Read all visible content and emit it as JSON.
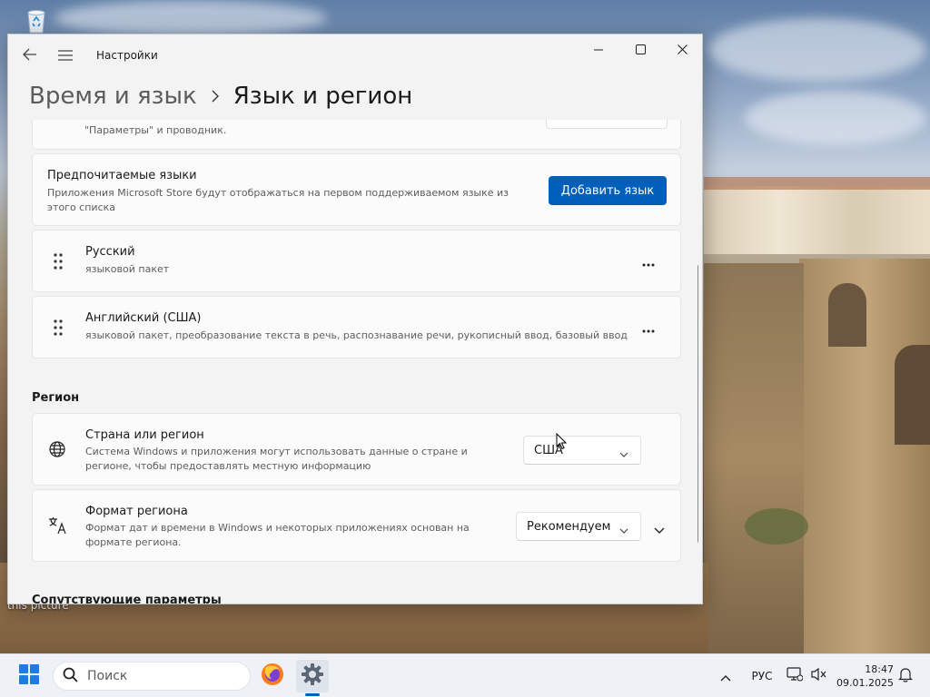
{
  "desktop": {
    "recycle_bin_icon": "recycle-bin-icon",
    "label": "this picture"
  },
  "window": {
    "app_title": "Настройки",
    "back_icon": "back-arrow-icon",
    "menu_icon": "hamburger-menu-icon",
    "controls": [
      "minimize-icon",
      "maximize-icon",
      "close-icon"
    ],
    "breadcrumb": {
      "parent": "Время и язык",
      "separator_icon": "chevron-right-icon",
      "current": "Язык и регион"
    }
  },
  "top_card": {
    "subtitle": "\"Параметры\" и проводник."
  },
  "preferred_languages": {
    "title": "Предпочитаемые языки",
    "subtitle": "Приложения Microsoft Store будут отображаться на первом поддерживаемом языке из этого списка",
    "add_button": "Добавить язык"
  },
  "languages": [
    {
      "name": "Русский",
      "details": "языковой пакет",
      "more_icon": "more-dots-icon",
      "grip_icon": "drag-handle-icon"
    },
    {
      "name": "Английский (США)",
      "details": "языковой пакет, преобразование текста в речь, распознавание речи, рукописный ввод, базовый ввод",
      "more_icon": "more-dots-icon",
      "grip_icon": "drag-handle-icon"
    }
  ],
  "region": {
    "section_title": "Регион",
    "country": {
      "icon": "globe-icon",
      "title": "Страна или регион",
      "subtitle": "Система Windows и приложения могут использовать данные о стране и регионе, чтобы предоставлять местную информацию",
      "value": "США"
    },
    "format": {
      "icon": "language-format-icon",
      "title": "Формат региона",
      "subtitle": "Формат дат и времени в Windows и некоторых приложениях основан на формате региона.",
      "value": "Рекомендуем",
      "expand_icon": "chevron-down-icon"
    }
  },
  "related": {
    "section_title": "Сопутствующие параметры"
  },
  "taskbar": {
    "start_icon": "windows-start-icon",
    "search_placeholder": "Поиск",
    "search_icon": "search-icon",
    "apps": [
      "firefox-icon",
      "settings-gear-icon"
    ],
    "tray_chevron_icon": "chevron-up-icon",
    "language": "РУС",
    "network_icon": "network-icon",
    "volume_icon": "volume-muted-icon",
    "time": "18:47",
    "date": "09.01.2025",
    "notification_icon": "notification-bell-icon"
  }
}
